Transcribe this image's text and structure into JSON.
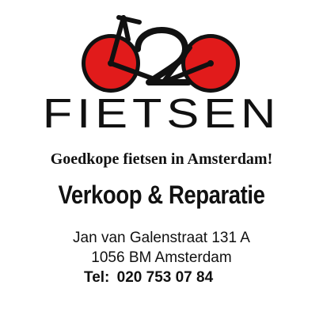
{
  "logo": {
    "digits": [
      "0",
      "2",
      "0"
    ],
    "wheel_color": "#e11b1b",
    "frame_color": "#111111",
    "icon": "bicycle-icon"
  },
  "brand": {
    "name": "FIETSEN"
  },
  "tagline": "Goedkope fietsen in Amsterdam!",
  "services": "Verkoop & Reparatie",
  "address": {
    "street": "Jan van Galenstraat 131 A",
    "city": "1056 BM Amsterdam"
  },
  "phone": {
    "label": "Tel:",
    "number": "020 753 07 84"
  },
  "colors": {
    "text": "#111111",
    "accent": "#e11b1b",
    "background": "#ffffff"
  }
}
